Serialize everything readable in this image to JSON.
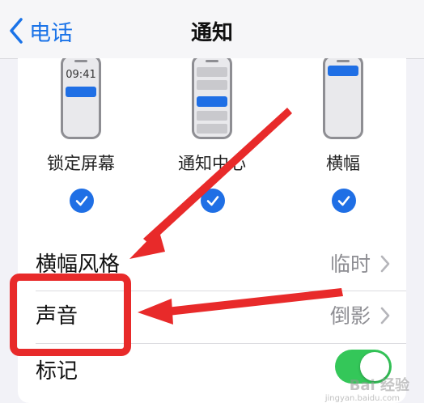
{
  "nav": {
    "back_label": "电话",
    "title": "通知"
  },
  "alert_styles": {
    "lock_screen_time": "09:41",
    "options": [
      {
        "label": "锁定屏幕",
        "checked": true
      },
      {
        "label": "通知中心",
        "checked": true
      },
      {
        "label": "横幅",
        "checked": true
      }
    ]
  },
  "rows": {
    "banner_style": {
      "label": "横幅风格",
      "value": "临时"
    },
    "sound": {
      "label": "声音",
      "value": "倒影"
    },
    "badges": {
      "label": "标记",
      "toggle_on": true
    }
  },
  "watermark": {
    "text": "Bai 经验",
    "sub": "jingyan.baidu.com"
  },
  "colors": {
    "accent": "#1f6fe5",
    "toggle_on": "#34c759",
    "annotation": "#e82a2a"
  }
}
